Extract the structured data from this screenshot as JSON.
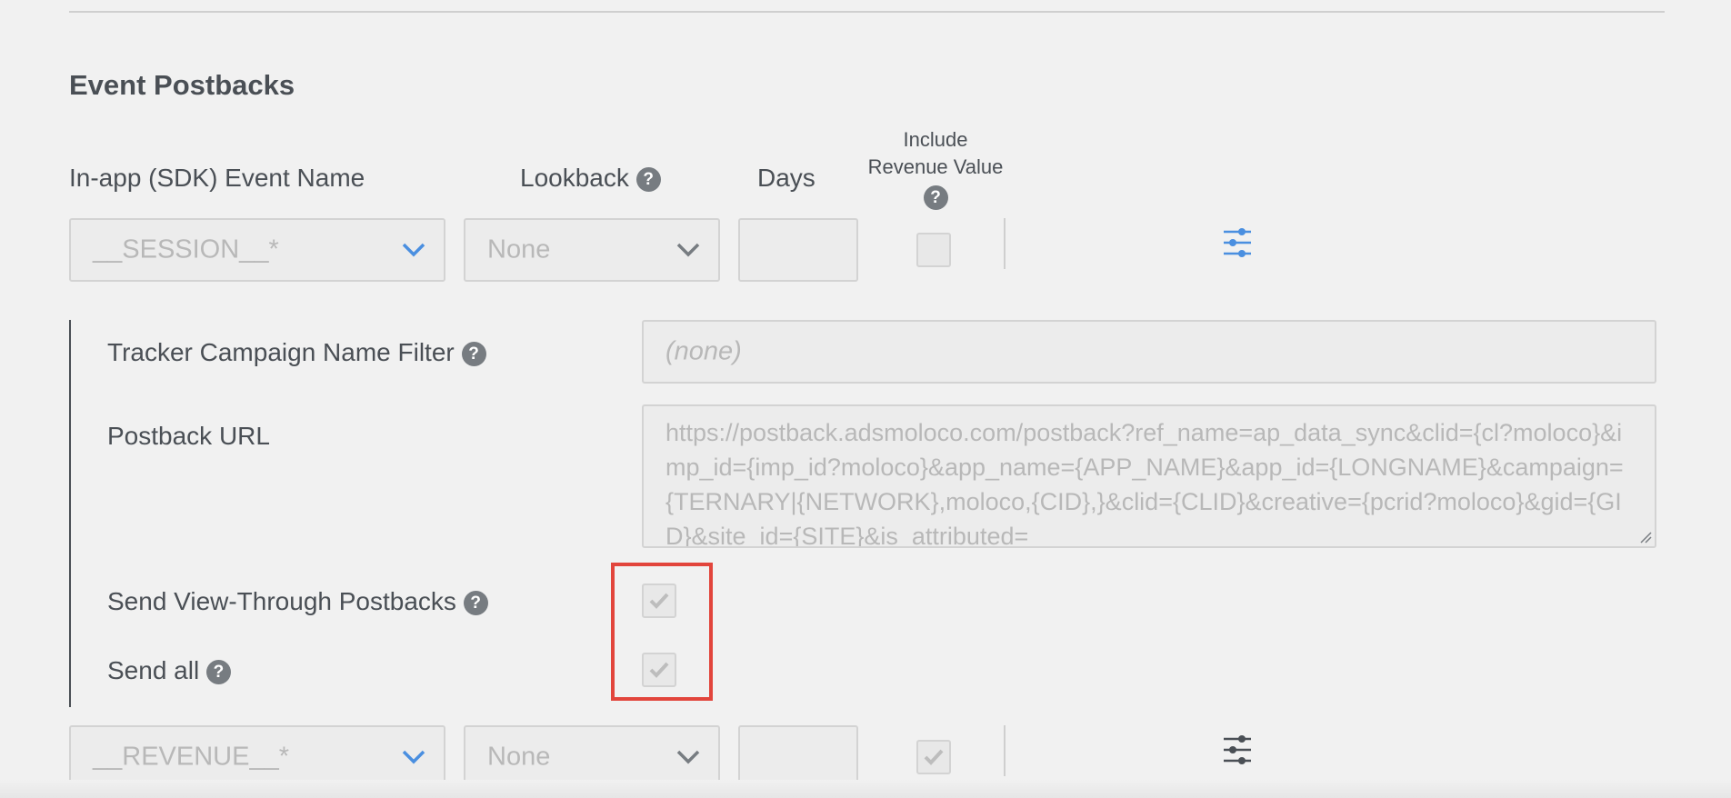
{
  "section": {
    "title": "Event Postbacks"
  },
  "columns": {
    "event_name": "In-app (SDK) Event Name",
    "lookback": "Lookback",
    "days": "Days",
    "include_revenue_line1": "Include",
    "include_revenue_line2": "Revenue Value"
  },
  "rows": [
    {
      "event_value": "__SESSION__*",
      "lookback_value": "None",
      "days_value": "",
      "include_revenue_checked": false
    },
    {
      "event_value": "__REVENUE__*",
      "lookback_value": "None",
      "days_value": "",
      "include_revenue_checked": true
    }
  ],
  "details": {
    "campaign_filter_label": "Tracker Campaign Name Filter",
    "campaign_filter_placeholder": "(none)",
    "postback_url_label": "Postback URL",
    "postback_url_value": "https://postback.adsmoloco.com/postback?ref_name=ap_data_sync&clid={cl?moloco}&imp_id={imp_id?moloco}&app_name={APP_NAME}&app_id={LONGNAME}&campaign={TERNARY|{NETWORK},moloco,{CID},}&clid={CLID}&creative={pcrid?moloco}&gid={GID}&site_id={SITE}&is_attributed=",
    "view_through_label": "Send View-Through Postbacks",
    "view_through_checked": true,
    "send_all_label": "Send all",
    "send_all_checked": true
  },
  "icons": {
    "help": "question-mark-icon",
    "dropdown": "chevron-down-icon",
    "settings": "sliders-icon",
    "check": "checkmark-icon"
  },
  "colors": {
    "accent_blue": "#4a8fe0",
    "highlight_red": "#e2453c",
    "muted_text": "#b8b8b8"
  }
}
